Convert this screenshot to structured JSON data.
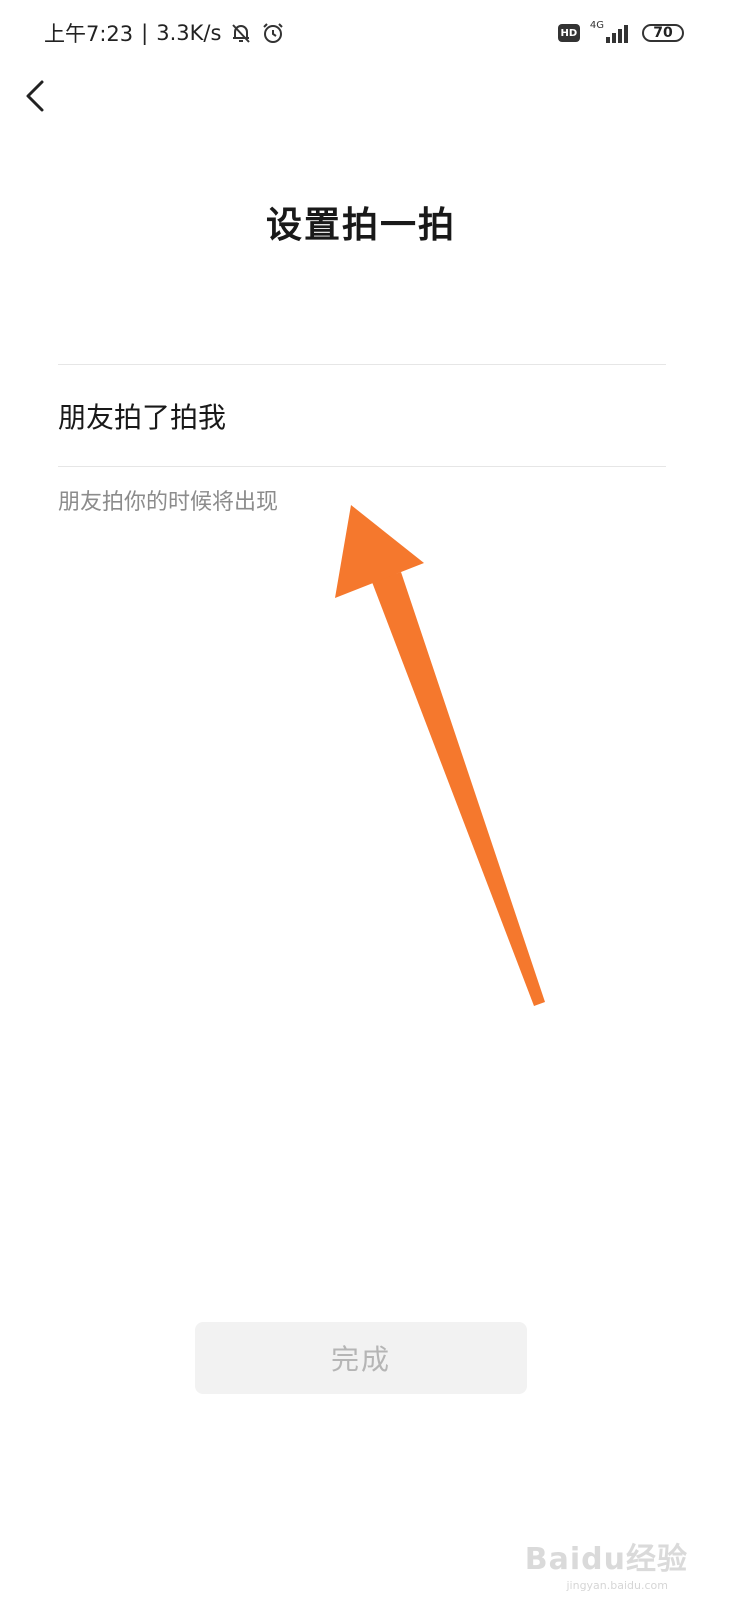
{
  "status_bar": {
    "time": "上午7:23",
    "separator": "|",
    "net_speed": "3.3K/s",
    "icons": [
      "bell-muted-icon",
      "alarm-icon",
      "hd-icon",
      "signal-icon",
      "battery-icon"
    ],
    "hd_label": "HD",
    "network": "4G",
    "battery": "70"
  },
  "nav": {
    "back_icon": "chevron-left-icon"
  },
  "page": {
    "title": "设置拍一拍"
  },
  "pat_field": {
    "value": "朋友拍了拍我",
    "hint": "朋友拍你的时候将出现"
  },
  "annotation": {
    "arrow_color": "#f5782d"
  },
  "footer": {
    "done_label": "完成"
  },
  "watermark": {
    "logo": "Baidu经验",
    "url": "jingyan.baidu.com"
  }
}
